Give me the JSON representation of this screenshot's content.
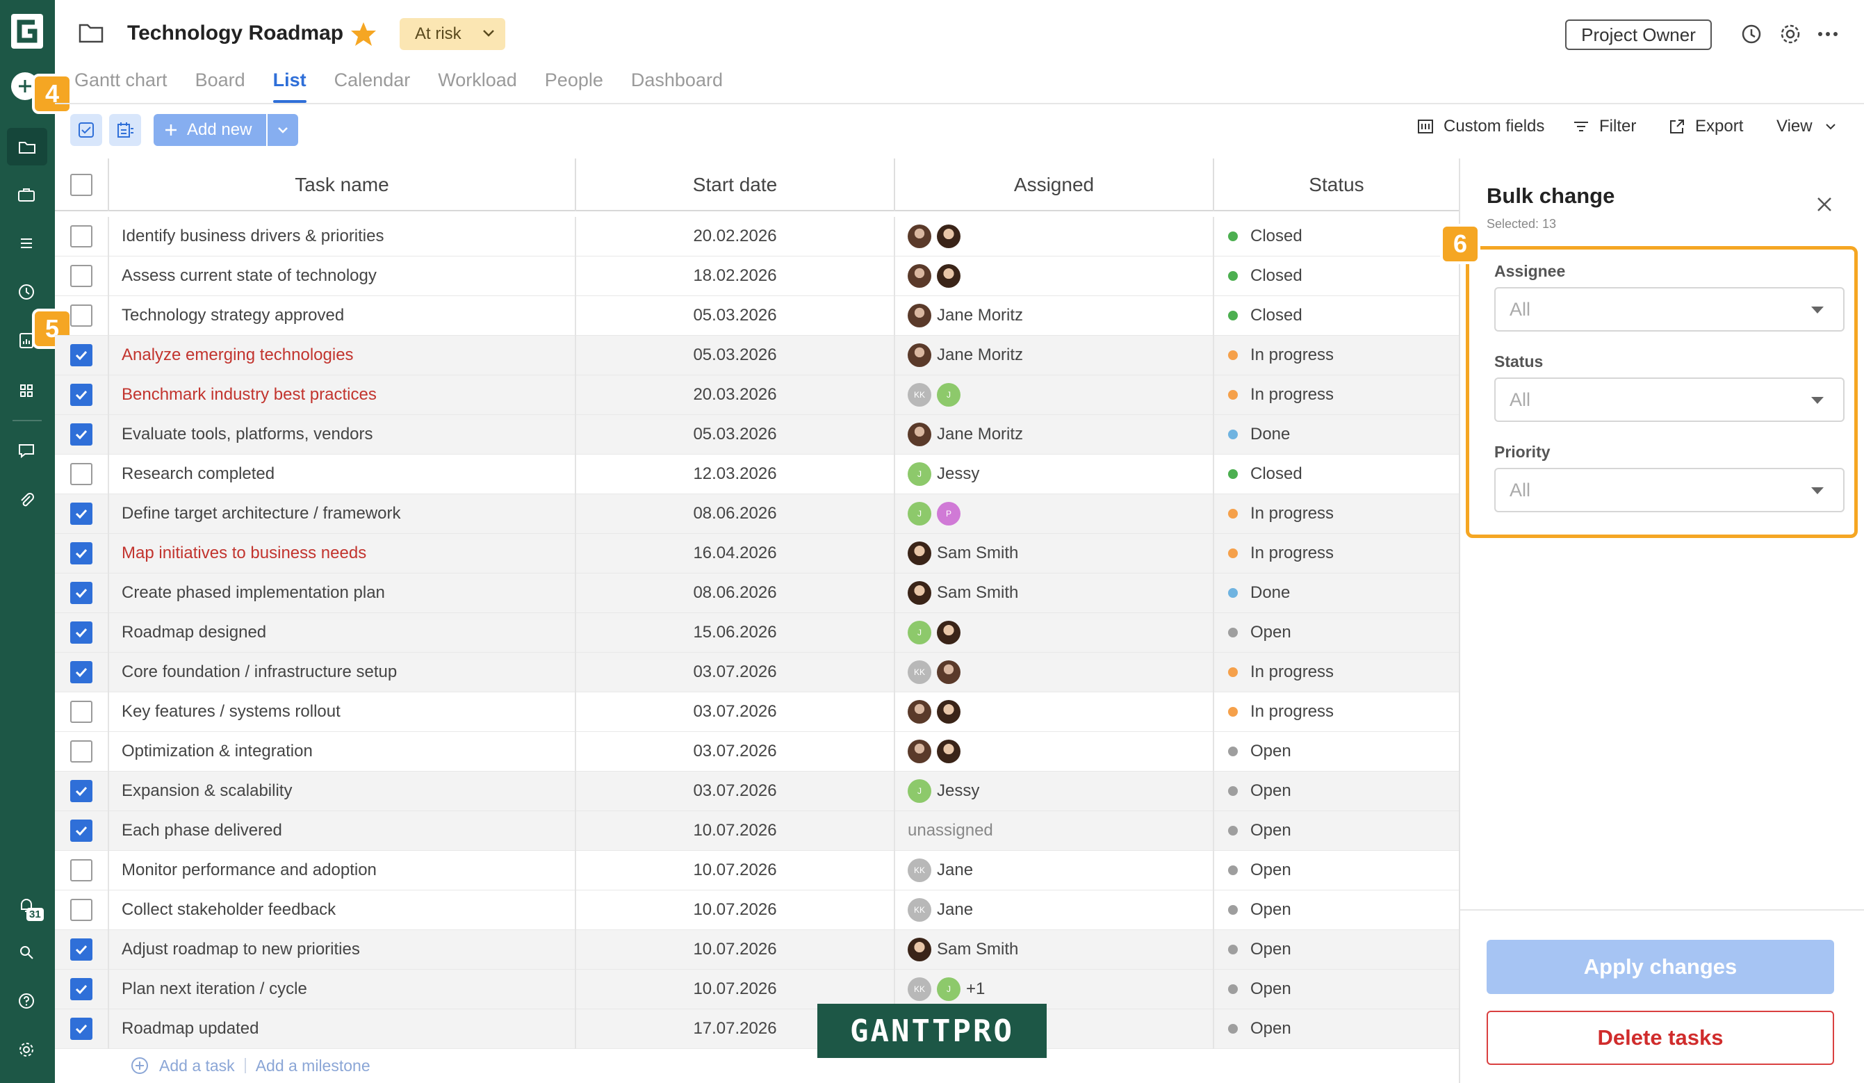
{
  "header": {
    "project_title": "Technology Roadmap",
    "status": "At risk",
    "role": "Project Owner"
  },
  "tabs": [
    {
      "label": "Gantt chart"
    },
    {
      "label": "Board"
    },
    {
      "label": "List",
      "active": true
    },
    {
      "label": "Calendar"
    },
    {
      "label": "Workload"
    },
    {
      "label": "People"
    },
    {
      "label": "Dashboard"
    }
  ],
  "toolbar": {
    "add_new": "Add new",
    "custom_fields": "Custom fields",
    "filter": "Filter",
    "export": "Export",
    "view": "View"
  },
  "callouts": {
    "c4": "4",
    "c5": "5",
    "c6": "6"
  },
  "sidebar": {
    "notification_count": "31"
  },
  "table": {
    "columns": [
      "Task name",
      "Start date",
      "Assigned",
      "Status"
    ],
    "rows": [
      {
        "checked": false,
        "name": "Identify business drivers & priorities",
        "date": "20.02.2026",
        "assignees": [
          "photo",
          "photo2"
        ],
        "assigned_text": "",
        "status": "Closed",
        "status_color": "#4caf50"
      },
      {
        "checked": false,
        "name": "Assess current state of technology",
        "date": "18.02.2026",
        "assignees": [
          "photo",
          "photo2"
        ],
        "assigned_text": "",
        "status": "Closed",
        "status_color": "#4caf50"
      },
      {
        "checked": false,
        "name": "Technology strategy approved",
        "date": "05.03.2026",
        "assignees": [
          "photo"
        ],
        "assigned_text": "Jane Moritz",
        "status": "Closed",
        "status_color": "#4caf50"
      },
      {
        "checked": true,
        "red": true,
        "name": "Analyze emerging technologies",
        "date": "05.03.2026",
        "assignees": [
          "photo"
        ],
        "assigned_text": "Jane Moritz",
        "status": "In progress",
        "status_color": "#f5a04a"
      },
      {
        "checked": true,
        "red": true,
        "name": "Benchmark industry best practices",
        "date": "20.03.2026",
        "assignees": [
          "kk",
          "j"
        ],
        "assigned_text": "",
        "status": "In progress",
        "status_color": "#f5a04a"
      },
      {
        "checked": true,
        "name": "Evaluate tools, platforms, vendors",
        "date": "05.03.2026",
        "assignees": [
          "photo"
        ],
        "assigned_text": "Jane Moritz",
        "status": "Done",
        "status_color": "#6fb3e0"
      },
      {
        "checked": false,
        "name": "Research completed",
        "date": "12.03.2026",
        "assignees": [
          "j"
        ],
        "assigned_text": "Jessy",
        "status": "Closed",
        "status_color": "#4caf50"
      },
      {
        "checked": true,
        "name": "Define target architecture / framework",
        "date": "08.06.2026",
        "assignees": [
          "j",
          "p"
        ],
        "assigned_text": "",
        "status": "In progress",
        "status_color": "#f5a04a"
      },
      {
        "checked": true,
        "red": true,
        "name": "Map initiatives to business needs",
        "date": "16.04.2026",
        "assignees": [
          "photo2"
        ],
        "assigned_text": "Sam Smith",
        "status": "In progress",
        "status_color": "#f5a04a"
      },
      {
        "checked": true,
        "name": "Create phased implementation plan",
        "date": "08.06.2026",
        "assignees": [
          "photo2"
        ],
        "assigned_text": "Sam Smith",
        "status": "Done",
        "status_color": "#6fb3e0"
      },
      {
        "checked": true,
        "name": "Roadmap designed",
        "date": "15.06.2026",
        "assignees": [
          "j",
          "photo2"
        ],
        "assigned_text": "",
        "status": "Open",
        "status_color": "#9e9e9e"
      },
      {
        "checked": true,
        "name": "Core foundation / infrastructure setup",
        "date": "03.07.2026",
        "assignees": [
          "kk",
          "photo"
        ],
        "assigned_text": "",
        "status": "In progress",
        "status_color": "#f5a04a"
      },
      {
        "checked": false,
        "name": "Key features / systems rollout",
        "date": "03.07.2026",
        "assignees": [
          "photo",
          "photo2"
        ],
        "assigned_text": "",
        "status": "In progress",
        "status_color": "#f5a04a"
      },
      {
        "checked": false,
        "name": "Optimization & integration",
        "date": "03.07.2026",
        "assignees": [
          "photo",
          "photo2"
        ],
        "assigned_text": "",
        "status": "Open",
        "status_color": "#9e9e9e"
      },
      {
        "checked": true,
        "name": "Expansion & scalability",
        "date": "03.07.2026",
        "assignees": [
          "j"
        ],
        "assigned_text": "Jessy",
        "status": "Open",
        "status_color": "#9e9e9e"
      },
      {
        "checked": true,
        "name": "Each phase delivered",
        "date": "10.07.2026",
        "assignees": [],
        "assigned_text": "unassigned",
        "status": "Open",
        "status_color": "#9e9e9e"
      },
      {
        "checked": false,
        "name": "Monitor performance and adoption",
        "date": "10.07.2026",
        "assignees": [
          "kk"
        ],
        "assigned_text": "Jane",
        "status": "Open",
        "status_color": "#9e9e9e"
      },
      {
        "checked": false,
        "name": "Collect stakeholder feedback",
        "date": "10.07.2026",
        "assignees": [
          "kk"
        ],
        "assigned_text": "Jane",
        "status": "Open",
        "status_color": "#9e9e9e"
      },
      {
        "checked": true,
        "name": "Adjust roadmap to new priorities",
        "date": "10.07.2026",
        "assignees": [
          "photo2"
        ],
        "assigned_text": "Sam Smith",
        "status": "Open",
        "status_color": "#9e9e9e"
      },
      {
        "checked": true,
        "name": "Plan next iteration / cycle",
        "date": "10.07.2026",
        "assignees": [
          "kk",
          "j"
        ],
        "assigned_text": "+1",
        "status": "Open",
        "status_color": "#9e9e9e"
      },
      {
        "checked": true,
        "name": "Roadmap updated",
        "date": "17.07.2026",
        "assignees": [],
        "assigned_text": "",
        "status": "Open",
        "status_color": "#9e9e9e"
      }
    ],
    "add_task": "Add a task",
    "add_milestone": "Add a milestone"
  },
  "avatar_initials": {
    "kk": "KK",
    "j": "J",
    "p": "P"
  },
  "watermark": "GANTTPRO",
  "panel": {
    "title": "Bulk change",
    "selected": "Selected: 13",
    "fields": [
      {
        "label": "Assignee",
        "value": "All"
      },
      {
        "label": "Status",
        "value": "All"
      },
      {
        "label": "Priority",
        "value": "All"
      }
    ],
    "apply": "Apply changes",
    "delete": "Delete tasks"
  },
  "colors": {
    "accent": "#2f6fd8",
    "rail": "#1d5746",
    "callout": "#f5a623",
    "danger": "#d02c2c"
  }
}
